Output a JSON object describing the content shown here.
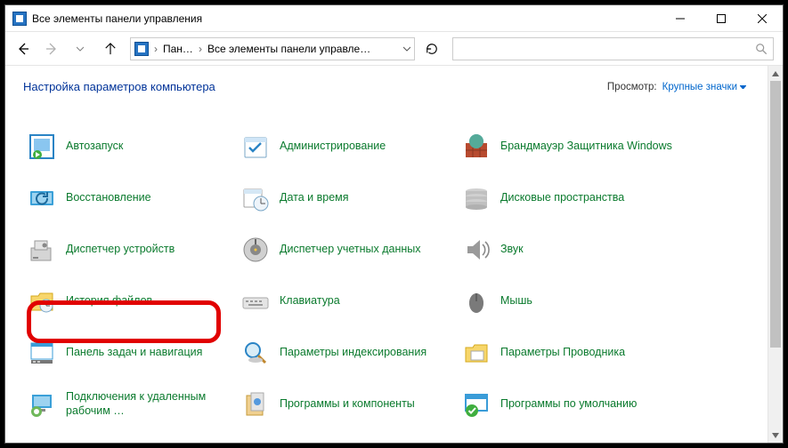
{
  "window": {
    "title": "Все элементы панели управления"
  },
  "nav": {
    "crumb1": "Пан…",
    "crumb2": "Все элементы панели управле…"
  },
  "header": {
    "title": "Настройка параметров компьютера",
    "view_label": "Просмотр:",
    "view_value": "Крупные значки"
  },
  "items": {
    "autorun": "Автозапуск",
    "admin": "Администрирование",
    "firewall": "Брандмауэр Защитника Windows",
    "recovery": "Восстановление",
    "datetime": "Дата и время",
    "storage": "Дисковые пространства",
    "devmgr": "Диспетчер устройств",
    "cred": "Диспетчер учетных данных",
    "sound": "Звук",
    "filehist": "История файлов",
    "keyboard": "Клавиатура",
    "mouse": "Мышь",
    "taskbar": "Панель задач и навигация",
    "indexing": "Параметры индексирования",
    "explorer": "Параметры Проводника",
    "rdp": "Подключения к удаленным рабочим …",
    "progs": "Программы и компоненты",
    "defaults": "Программы по умолчанию"
  }
}
